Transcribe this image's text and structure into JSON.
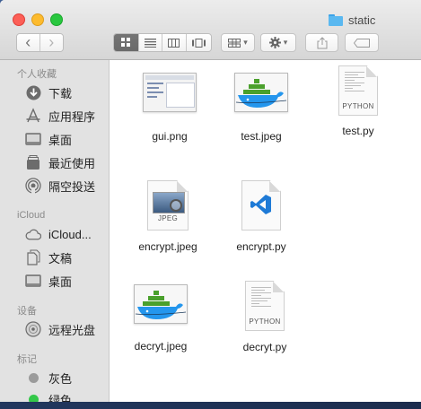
{
  "window": {
    "title": "static"
  },
  "toolbar": {
    "back": "‹",
    "forward": "›",
    "chevron": "▾"
  },
  "sidebar": {
    "favorites_header": "个人收藏",
    "favorites": [
      {
        "label": "下载",
        "icon": "download-icon"
      },
      {
        "label": "应用程序",
        "icon": "applications-icon"
      },
      {
        "label": "桌面",
        "icon": "desktop-icon"
      },
      {
        "label": "最近使用",
        "icon": "recents-icon"
      },
      {
        "label": "隔空投送",
        "icon": "airdrop-icon"
      }
    ],
    "icloud_header": "iCloud",
    "icloud": [
      {
        "label": "iCloud...",
        "icon": "cloud-icon"
      },
      {
        "label": "文稿",
        "icon": "documents-icon"
      },
      {
        "label": "桌面",
        "icon": "desktop-icon"
      }
    ],
    "devices_header": "设备",
    "devices": [
      {
        "label": "远程光盘",
        "icon": "disc-icon"
      }
    ],
    "tags_header": "标记",
    "tags": [
      {
        "label": "灰色",
        "color": "#9b9b9b"
      },
      {
        "label": "绿色",
        "color": "#34c84a"
      }
    ]
  },
  "files": [
    {
      "name": "gui.png",
      "kind": "screenshot-thumbnail"
    },
    {
      "name": "test.jpeg",
      "kind": "docker-thumbnail"
    },
    {
      "name": "test.py",
      "kind": "python-file",
      "tag": "PYTHON"
    },
    {
      "name": "encrypt.jpeg",
      "kind": "jpeg-file",
      "tag": "JPEG"
    },
    {
      "name": "encrypt.py",
      "kind": "vscode-file"
    },
    {
      "name": "decryt.jpeg",
      "kind": "docker-thumbnail"
    },
    {
      "name": "decryt.py",
      "kind": "python-file",
      "tag": "PYTHON"
    }
  ],
  "colors": {
    "accent_blue": "#1e7ad6",
    "docker_blue": "#2496ed",
    "docker_green": "#4aa02c"
  }
}
